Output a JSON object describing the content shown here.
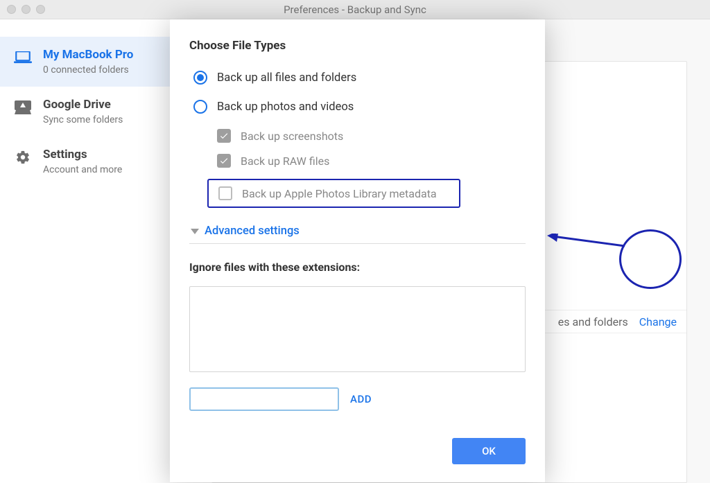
{
  "window": {
    "title": "Preferences - Backup and Sync"
  },
  "sidebar": {
    "items": [
      {
        "title": "My MacBook Pro",
        "sub": "0 connected folders"
      },
      {
        "title": "Google Drive",
        "sub": "Sync some folders"
      },
      {
        "title": "Settings",
        "sub": "Account and more"
      }
    ]
  },
  "bg": {
    "es_text": "es and folders",
    "change": "Change"
  },
  "dialog": {
    "heading": "Choose File Types",
    "opt1": "Back up all files and folders",
    "opt2": "Back up photos and videos",
    "sub1": "Back up screenshots",
    "sub2": "Back up RAW files",
    "sub3": "Back up Apple Photos Library metadata",
    "adv": "Advanced settings",
    "ignore": "Ignore files with these extensions:",
    "add": "ADD",
    "ok": "OK"
  }
}
